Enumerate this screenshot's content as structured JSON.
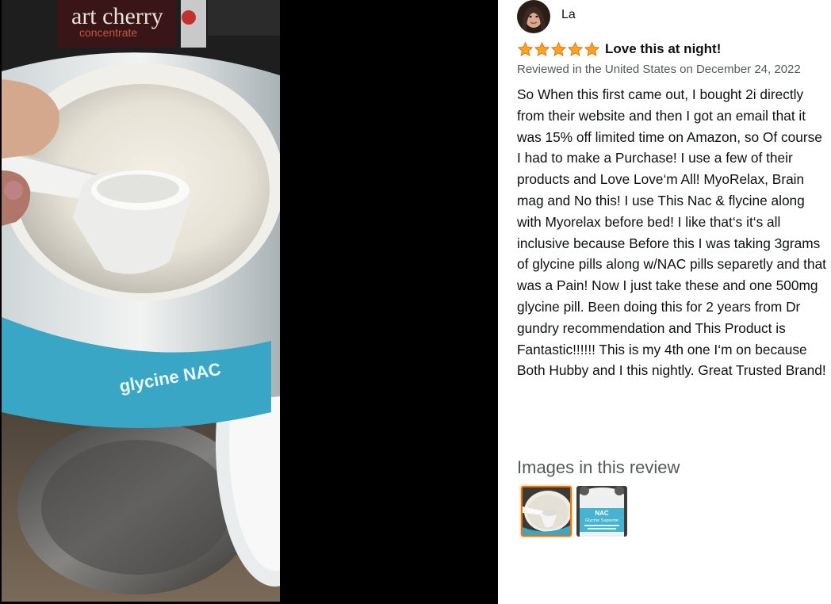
{
  "viewer": {
    "photo_label_text": "art cherry",
    "photo_sub_text": "concentrate",
    "jar_label_text": "glycine NAC"
  },
  "reviewer": {
    "name": "La",
    "avatar_icon": "user-avatar-icon"
  },
  "review": {
    "rating": 5,
    "rating_max": 5,
    "title": "Love this at night!",
    "date": "Reviewed in the United States on December 24, 2022",
    "body": "So When this first came out, I bought 2i directly from their website and then I got an email that it was 15% off limited time on Amazon, so Of course I had to make a Purchase! I use a few of their products and Love Love‘m All! MyoRelax, Brain mag and No this! I use This Nac & flycine along with Myorelax before bed! I like that‘s it‘s all inclusive because Before this I was taking 3grams of glycine pills along w/NAC pills separetly and that was a Pain! Now I just take these and one 500mg glycine pill. Been doing this for 2 years from Dr gundry recommendation and This Product is Fantastic!!!!!! This is my 4th one I‘m on because Both Hubby and I this nightly. Great Trusted Brand!"
  },
  "images_section": {
    "heading": "Images in this review",
    "thumbnails": [
      {
        "label": "scoop-in-jar",
        "selected": true
      },
      {
        "label": "NAC glycine supreme jar",
        "selected": false
      }
    ],
    "thumb2_text": "NAC",
    "thumb2_sub": "Glycine Supreme"
  },
  "colors": {
    "star": "#ffa41c",
    "star_outline": "#de7921",
    "selected_border": "#e77600",
    "meta_text": "#565959",
    "body_text": "#0f1111"
  }
}
